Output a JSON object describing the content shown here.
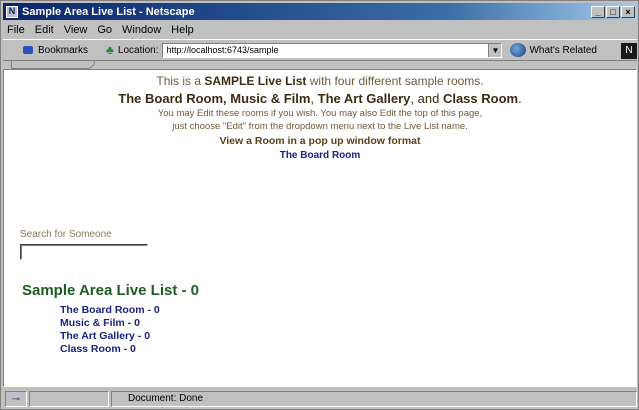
{
  "window": {
    "title": "Sample Area Live List - Netscape",
    "buttons": {
      "minimize": "_",
      "maximize": "□",
      "close": "×"
    }
  },
  "menubar": {
    "items": [
      {
        "label": "File"
      },
      {
        "label": "Edit"
      },
      {
        "label": "View"
      },
      {
        "label": "Go"
      },
      {
        "label": "Window"
      },
      {
        "label": "Help"
      }
    ]
  },
  "toolbar": {
    "bookmarks_label": "Bookmarks",
    "location_label": "Location:",
    "url_value": "http://localhost:6743/sample",
    "related_label": "What's Related"
  },
  "page": {
    "intro_prefix": "This is a",
    "intro_bold": "SAMPLE Live List",
    "intro_suffix": "with four different sample rooms.",
    "line2_a": "The Board Room, Music & Film",
    "line2_b": "The Art Gallery",
    "line2_c": "Class Room",
    "line2_sep1": ",",
    "line2_sep2": ", and",
    "line2_end": ".",
    "small1": "You may Edit these rooms if you wish. You may also Edit the top of this page,",
    "small2": "just choose \"Edit\" from the dropdown menu next to the Live List name.",
    "view_link": "View a Room in a pop up window format",
    "board_link": "The Board Room",
    "search_label": "Search for Someone",
    "search_value": "",
    "live_list_title": "Sample Area Live List - 0",
    "rooms": [
      {
        "label": "The Board Room - 0"
      },
      {
        "label": "Music & Film - 0"
      },
      {
        "label": "The Art Gallery - 0"
      },
      {
        "label": "Class Room - 0"
      }
    ]
  },
  "status": {
    "text": "Document: Done"
  }
}
